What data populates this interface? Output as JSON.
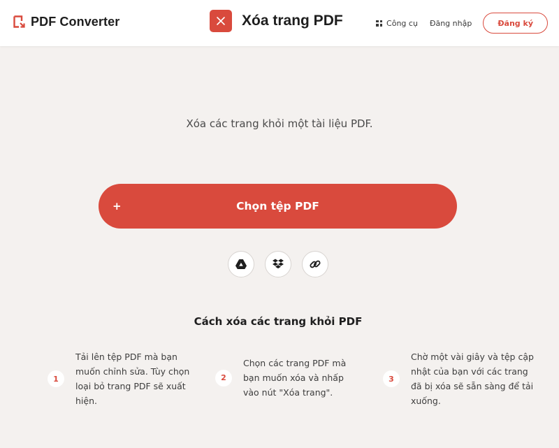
{
  "colors": {
    "accent": "#d94a3d",
    "background": "#f4f1ef",
    "header_bg": "#ffffff"
  },
  "header": {
    "logo_icon": "pdf-converter-logo-icon",
    "logo_text": "PDF Converter",
    "tool_icon": "close-x-icon",
    "tool_title": "Xóa trang PDF",
    "nav": {
      "tools_icon": "grid-icon",
      "tools_label": "Công cụ",
      "login_label": "Đăng nhập",
      "signup_label": "Đăng ký"
    }
  },
  "main": {
    "subtitle": "Xóa các trang khỏi một tài liệu PDF.",
    "choose_button": {
      "icon_text": "+",
      "label": "Chọn tệp PDF"
    },
    "sources": [
      {
        "icon": "google-drive-icon"
      },
      {
        "icon": "dropbox-icon"
      },
      {
        "icon": "link-icon"
      }
    ],
    "how_to": {
      "title": "Cách xóa các trang khỏi PDF",
      "steps": [
        {
          "number": "1",
          "text": "Tải lên tệp PDF mà bạn muốn chỉnh sửa. Tùy chọn loại bỏ trang PDF sẽ xuất hiện."
        },
        {
          "number": "2",
          "text": "Chọn các trang PDF mà bạn muốn xóa và nhấp vào nút \"Xóa trang\"."
        },
        {
          "number": "3",
          "text": "Chờ một vài giây và tệp cập nhật của bạn với các trang đã bị xóa sẽ sẵn sàng để tải xuống."
        }
      ]
    }
  }
}
